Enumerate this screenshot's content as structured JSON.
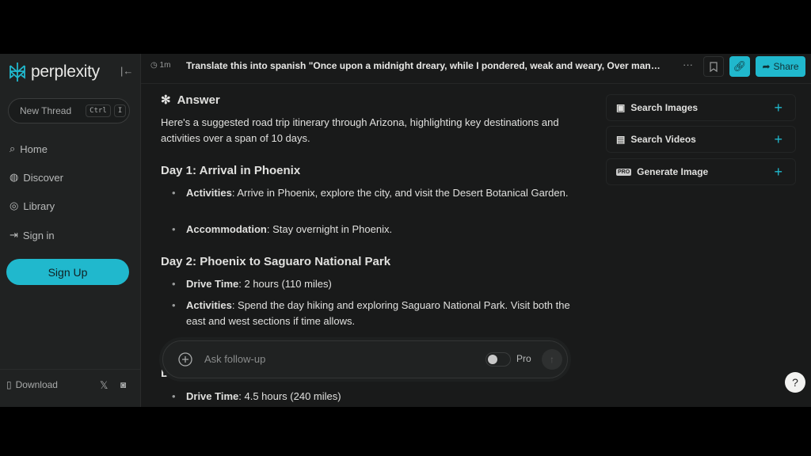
{
  "brand": {
    "name": "perplexity",
    "accent": "#20b8cd"
  },
  "sidebar": {
    "new_thread": "New Thread",
    "shortcut": [
      "Ctrl",
      "I"
    ],
    "items": [
      {
        "label": "Home",
        "icon": "home-search-icon"
      },
      {
        "label": "Discover",
        "icon": "globe-icon"
      },
      {
        "label": "Library",
        "icon": "library-icon"
      },
      {
        "label": "Sign in",
        "icon": "sign-in-icon"
      }
    ],
    "signup": "Sign Up",
    "download": "Download"
  },
  "topbar": {
    "time": "1m",
    "title": "Translate this into spanish \"Once upon a midnight dreary, while I pondered, weak and weary, Over many a qu...",
    "share": "Share"
  },
  "answer": {
    "heading": "Answer",
    "intro": "Here's a suggested road trip itinerary through Arizona, highlighting key destinations and activities over a span of 10 days.",
    "days": [
      {
        "title": "Day 1: Arrival in Phoenix",
        "items": [
          {
            "label": "Activities",
            "text": ": Arrive in Phoenix, explore the city, and visit the Desert Botanical Garden."
          },
          {
            "label": "Accommodation",
            "text": ": Stay overnight in Phoenix."
          }
        ]
      },
      {
        "title": "Day 2: Phoenix to Saguaro National Park",
        "items": [
          {
            "label": "Drive Time",
            "text": ": 2 hours (110 miles)"
          },
          {
            "label": "Activities",
            "text": ": Spend the day hiking and exploring Saguaro National Park. Visit both the east and west sections if time allows."
          }
        ]
      },
      {
        "title": "D",
        "items": [
          {
            "label": "Drive Time",
            "text": ": 4.5 hours (240 miles)"
          }
        ]
      }
    ]
  },
  "right_panel": [
    {
      "label": "Search Images",
      "icon": "image-icon"
    },
    {
      "label": "Search Videos",
      "icon": "film-icon"
    },
    {
      "label": "Generate Image",
      "icon": "pro-badge-icon"
    }
  ],
  "followup": {
    "placeholder": "Ask follow-up",
    "pro_label": "Pro",
    "pro_enabled": false
  },
  "help": "?"
}
